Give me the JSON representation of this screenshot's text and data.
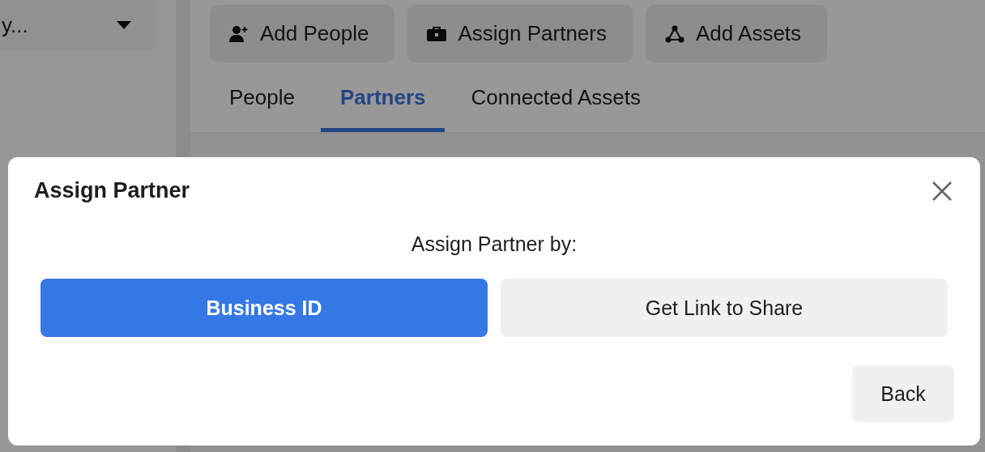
{
  "sidebar": {
    "dropdown": {
      "label": "y..."
    }
  },
  "toolbar": {
    "buttons": [
      {
        "label": "Add People",
        "kind": "person-add"
      },
      {
        "label": "Assign Partners",
        "kind": "briefcase"
      },
      {
        "label": "Add Assets",
        "kind": "nodes"
      }
    ]
  },
  "tabs": [
    {
      "label": "People",
      "selected": false
    },
    {
      "label": "Partners",
      "selected": true
    },
    {
      "label": "Connected Assets",
      "selected": false
    }
  ],
  "dialog": {
    "title": "Assign Partner",
    "prompt": "Assign Partner by:",
    "options": [
      {
        "label": "Business ID",
        "selected": true
      },
      {
        "label": "Get Link to Share",
        "selected": false
      }
    ],
    "back_button": "Back"
  }
}
